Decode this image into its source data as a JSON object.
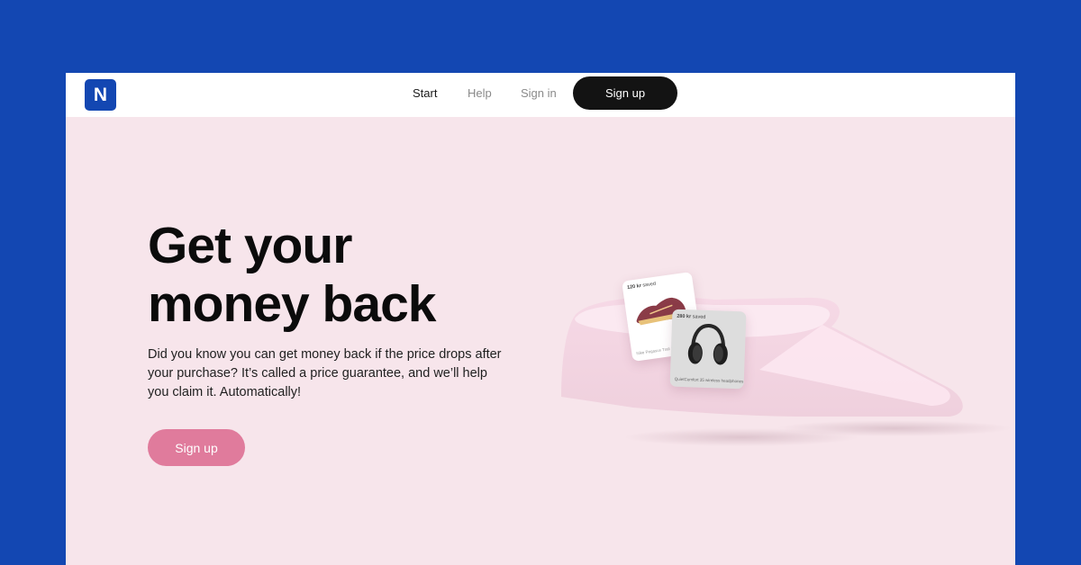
{
  "nav": {
    "logo_letter": "N",
    "links": [
      {
        "label": "Start",
        "active": true
      },
      {
        "label": "Help",
        "active": false
      },
      {
        "label": "Sign in",
        "active": false
      }
    ],
    "signup_label": "Sign up"
  },
  "hero": {
    "title_line1": "Get your",
    "title_line2": "money back",
    "description": "Did you know you can get money back if the price drops after your purchase? It’s called a price guarantee, and we’ll help you claim it. Automatically!",
    "signup_label": "Sign up"
  },
  "cards": [
    {
      "amount": "120 kr",
      "suffix": "saved",
      "product": "Nike Pegasus Trail 3"
    },
    {
      "amount": "280 kr",
      "suffix": "saved",
      "product": "QuietComfort 35 wireless headphones"
    }
  ],
  "colors": {
    "background": "#1347B2",
    "hero_background": "#F7E5EB",
    "nav_signup": "#131313",
    "hero_signup": "#E07B9C",
    "logo": "#1347B2"
  }
}
